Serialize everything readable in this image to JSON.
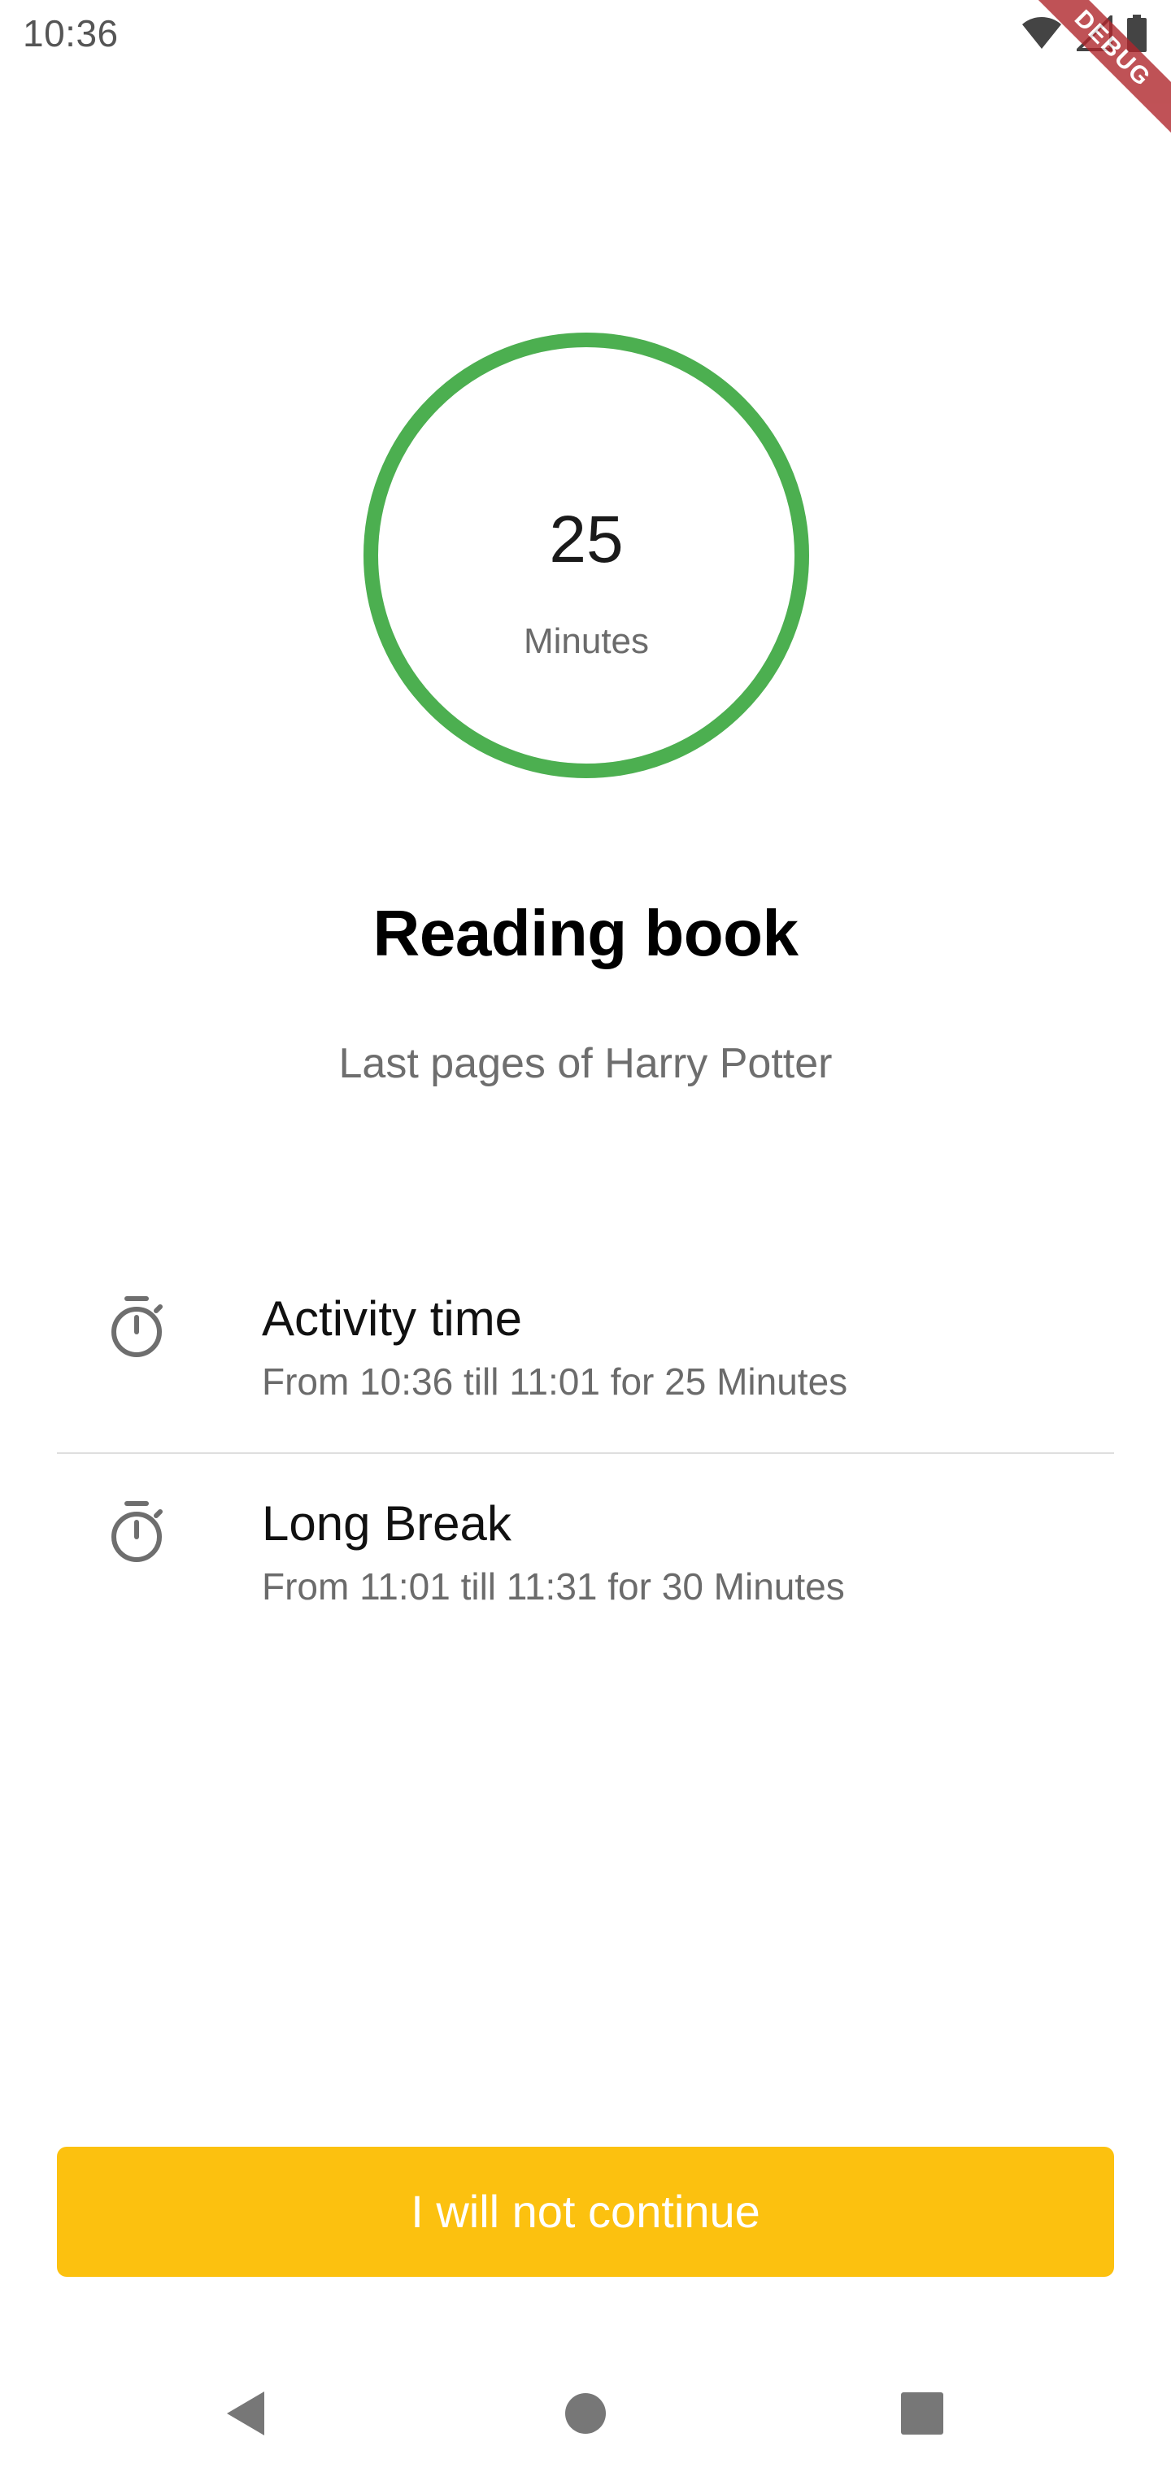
{
  "status_bar": {
    "time": "10:36",
    "icons": [
      "wifi-icon",
      "signal-icon",
      "battery-icon"
    ],
    "debug_label": "DEBUG"
  },
  "timer": {
    "value": "25",
    "unit": "Minutes",
    "progress": 1.0,
    "ring_color": "#4caf50"
  },
  "task": {
    "title": "Reading book",
    "subtitle": "Last pages of Harry Potter"
  },
  "schedule": [
    {
      "icon": "stopwatch-icon",
      "title": "Activity time",
      "detail": "From 10:36 till 11:01 for 25 Minutes"
    },
    {
      "icon": "stopwatch-icon",
      "title": "Long Break",
      "detail": "From 11:01 till 11:31 for 30 Minutes"
    }
  ],
  "action": {
    "label": "I will not continue",
    "color": "#fcc10f"
  },
  "nav": [
    "back-icon",
    "home-icon",
    "recents-icon"
  ]
}
